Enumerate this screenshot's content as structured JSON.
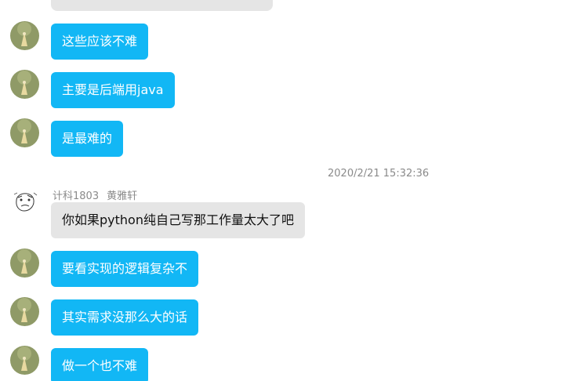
{
  "colors": {
    "my_bubble": "#12b7f5",
    "other_bubble": "#e5e5e5",
    "meta_text": "#8a8a8a"
  },
  "messages": [
    {
      "side": "mine",
      "text": "这些应该不难"
    },
    {
      "side": "mine",
      "text": "主要是后端用java"
    },
    {
      "side": "mine",
      "text": "是最难的"
    }
  ],
  "timestamp": "2020/2/21 15:32:36",
  "other_sender": {
    "id": "计科1803",
    "name": "黄雅轩"
  },
  "other_message": "你如果python纯自己写那工作量太大了吧",
  "messages_after": [
    {
      "side": "mine",
      "text": "要看实现的逻辑复杂不"
    },
    {
      "side": "mine",
      "text": "其实需求没那么大的话"
    },
    {
      "side": "mine",
      "text": "做一个也不难"
    }
  ],
  "icons": {
    "my_avatar": "green-cartoon-avatar-icon",
    "other_avatar": "sketch-face-avatar-icon"
  }
}
